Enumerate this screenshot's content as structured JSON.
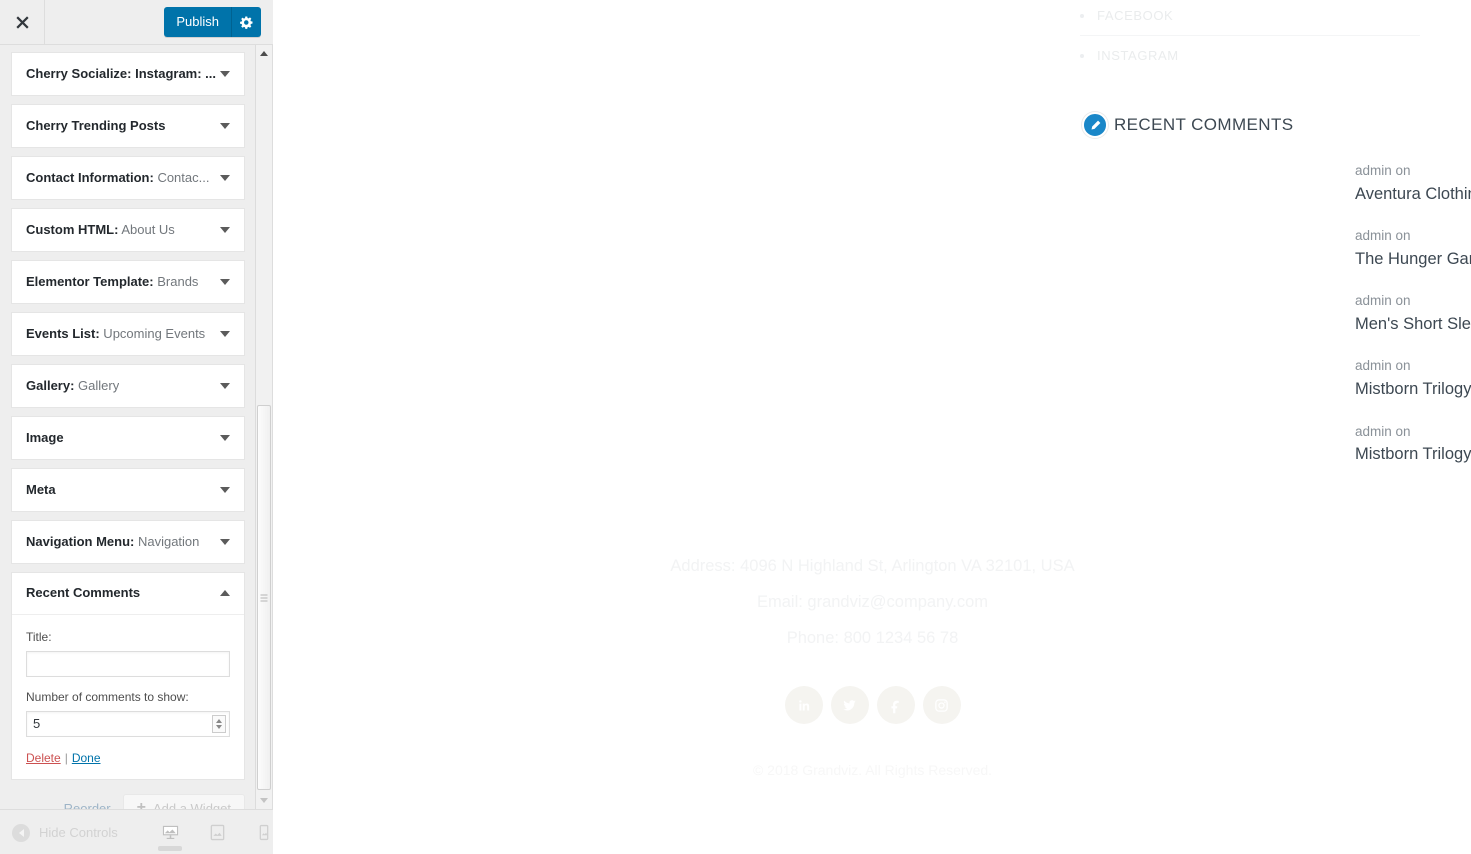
{
  "customizer": {
    "header": {
      "close_icon": "close-icon",
      "publish_label": "Publish",
      "gear_icon": "gear-icon"
    },
    "widgets": [
      {
        "title": "Cherry Socialize: Instagram: ...",
        "subtitle": "",
        "open": false
      },
      {
        "title": "Cherry Trending Posts",
        "subtitle": "",
        "open": false
      },
      {
        "title": "Contact Information:",
        "subtitle": " Contac...",
        "open": false
      },
      {
        "title": "Custom HTML:",
        "subtitle": " About Us",
        "open": false
      },
      {
        "title": "Elementor Template:",
        "subtitle": " Brands",
        "open": false
      },
      {
        "title": "Events List:",
        "subtitle": " Upcoming Events",
        "open": false
      },
      {
        "title": "Gallery:",
        "subtitle": " Gallery",
        "open": false
      },
      {
        "title": "Image",
        "subtitle": "",
        "open": false
      },
      {
        "title": "Meta",
        "subtitle": "",
        "open": false
      },
      {
        "title": "Navigation Menu:",
        "subtitle": " Navigation",
        "open": false
      },
      {
        "title": "Recent Comments",
        "subtitle": "",
        "open": true
      }
    ],
    "recent_comments_widget": {
      "title_label": "Title:",
      "title_value": "",
      "title_placeholder": "",
      "count_label": "Number of comments to show:",
      "count_value": "5",
      "delete_label": "Delete",
      "separator": "|",
      "done_label": "Done"
    },
    "footer_controls": {
      "reorder_label": "Reorder",
      "add_widget_label": "Add a Widget"
    },
    "bottom_bar": {
      "hide_controls_label": "Hide Controls",
      "devices": [
        {
          "name": "desktop",
          "active": true
        },
        {
          "name": "tablet",
          "active": false
        },
        {
          "name": "mobile",
          "active": false
        }
      ]
    }
  },
  "preview": {
    "social_nav": [
      {
        "label": "FACEBOOK"
      },
      {
        "label": "INSTAGRAM"
      }
    ],
    "recent_comments": {
      "heading": "RECENT COMMENTS",
      "items": [
        {
          "author": "admin on",
          "post": "Aventura Clothing Marlowe Short Sleeve"
        },
        {
          "author": "admin on",
          "post": "The Hunger Games Trilogy"
        },
        {
          "author": "admin on",
          "post": "Men's Short Sleeve T-Shirt"
        },
        {
          "author": "admin on",
          "post": "Mistborn Trilogy by Brandon Sanderson"
        },
        {
          "author": "admin on",
          "post": "Mistborn Trilogy by Brandon Sanderson"
        }
      ]
    },
    "contacts": {
      "address": "Address: 4096 N Highland St, Arlington VA 32101, USA",
      "email": "Email: grandviz@company.com",
      "phone": "Phone: 800 1234 56 78"
    },
    "social_icons": [
      {
        "name": "linkedin-icon"
      },
      {
        "name": "twitter-icon"
      },
      {
        "name": "facebook-icon"
      },
      {
        "name": "instagram-icon"
      }
    ],
    "copyright": "© 2018 Grandviz. All Rights Reserved."
  },
  "colors": {
    "accent": "#0073aa",
    "edit_pin": "#1a87c8",
    "delete_link": "#cc5151",
    "sidebar_bg": "#eeeeee"
  }
}
